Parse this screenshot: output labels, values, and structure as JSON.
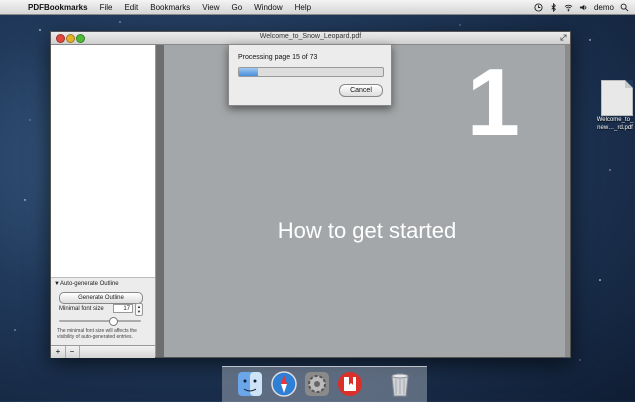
{
  "menubar": {
    "app_name": "PDFBookmarks",
    "items": [
      "File",
      "Edit",
      "Bookmarks",
      "View",
      "Go",
      "Window",
      "Help"
    ],
    "user": "demo"
  },
  "desktop": {
    "file_label": "Welcome_to_ new…_rd.pdf"
  },
  "window": {
    "title": "Welcome_to_Snow_Leopard.pdf"
  },
  "sidebar": {
    "panel_title": "▼Auto-generate Outline",
    "generate_button": "Generate Outline",
    "font_size_label": "Minimal font size",
    "font_size_value": "17",
    "note": "The minimal font size will affects the visibility of auto-generated entries.",
    "add_label": "+",
    "remove_label": "−"
  },
  "page": {
    "big_number": "1",
    "heading": "How to get started"
  },
  "progress": {
    "text": "Processing page 15 of 73",
    "fraction": 0.13,
    "cancel_label": "Cancel"
  },
  "dock": {
    "icons": [
      "finder-icon",
      "safari-icon",
      "system-preferences-icon",
      "pdfbookmarks-icon",
      "trash-icon"
    ]
  },
  "colors": {
    "accent": "#4a8fdc",
    "page_bg": "#a4a7a9"
  }
}
